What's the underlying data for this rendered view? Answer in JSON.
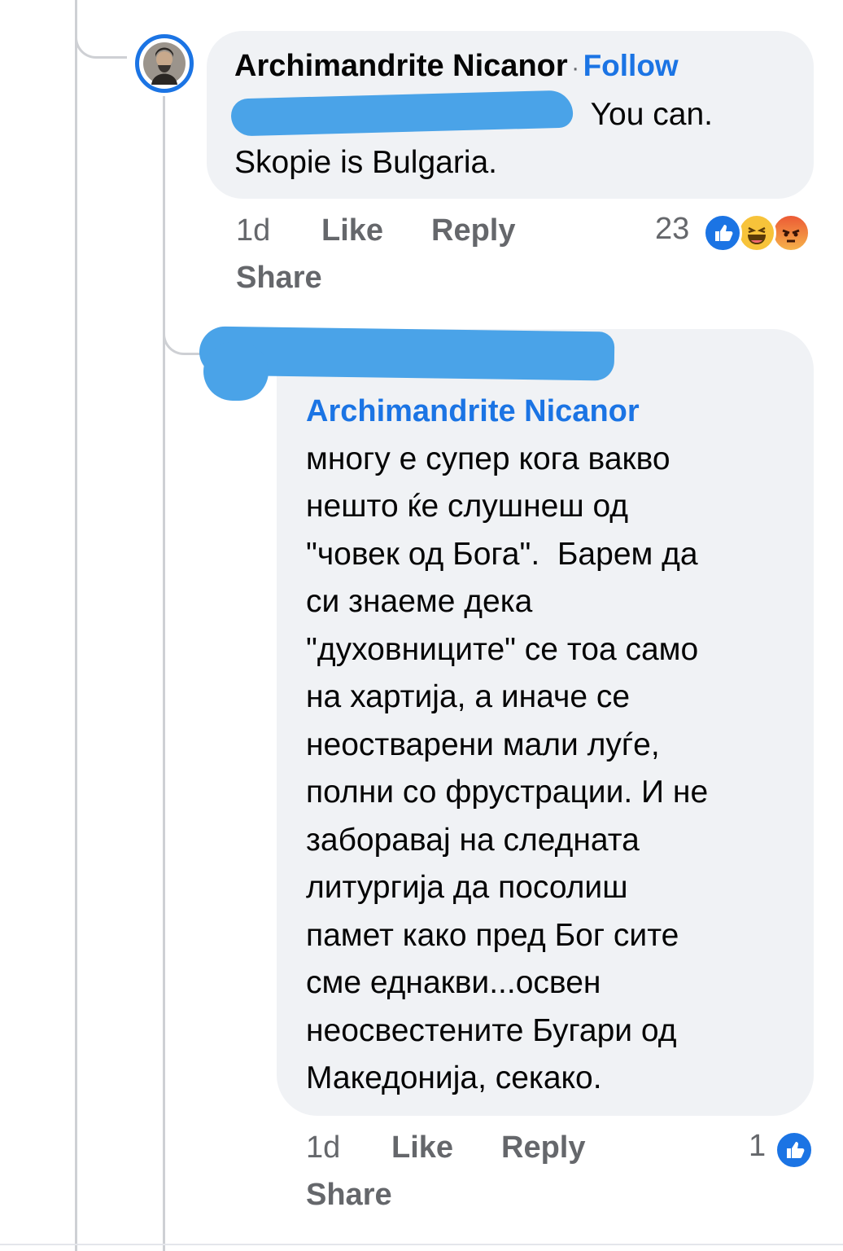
{
  "comments": [
    {
      "author": "Archimandrite Nicanor",
      "separator": "·",
      "follow_label": "Follow",
      "text_line1": "You can.",
      "text_line2": "Skopie is Bulgaria.",
      "time": "1d",
      "like_label": "Like",
      "reply_label": "Reply",
      "share_label": "Share",
      "reaction_count": "23",
      "reactions": [
        "like-icon",
        "haha-icon",
        "angry-icon"
      ]
    },
    {
      "mention": "Archimandrite Nicanor",
      "text_lines": [
        "многу е супер кога вакво",
        "нешто ќе слушнеш од",
        "\"човек од Бога\".  Барем да",
        "си знаеме дека",
        "\"духовниците\" се тоа само",
        "на хартија, а иначе се",
        "неостварени мали луѓе,",
        "полни со фрустрации. И не",
        "заборавај на следната",
        "литургија да посолиш",
        "памет како пред Бог сите",
        "сме еднакви...освен",
        "неосвестените Бугари од",
        "Македонија, секако."
      ],
      "time": "1d",
      "like_label": "Like",
      "reply_label": "Reply",
      "share_label": "Share",
      "reaction_count": "1",
      "reactions": [
        "like-icon"
      ]
    }
  ],
  "colors": {
    "bubble": "#f0f2f5",
    "link": "#1b74e4",
    "meta": "#65676b",
    "thread_line": "#ced0d4",
    "redaction": "#4aa3e8"
  }
}
